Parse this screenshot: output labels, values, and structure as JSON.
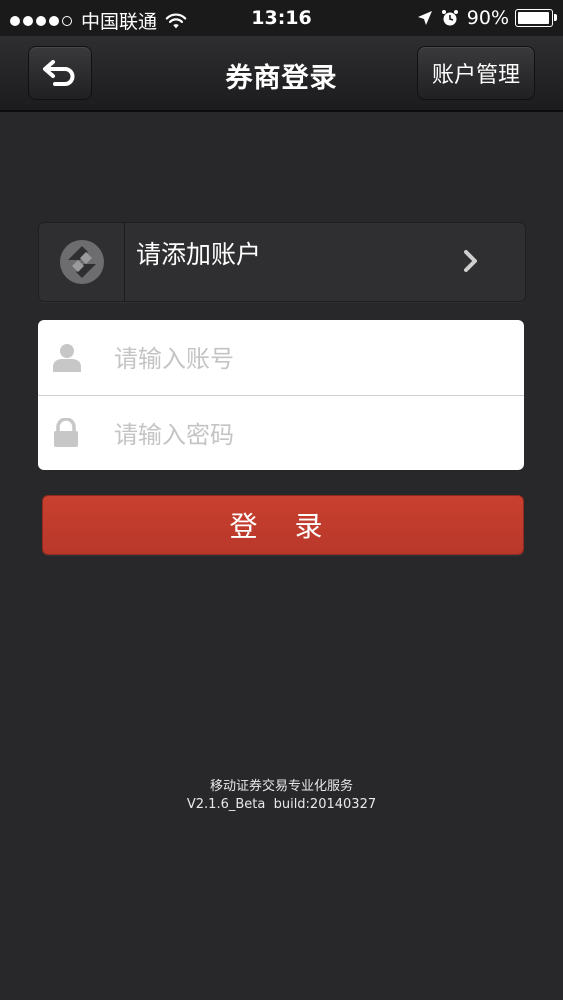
{
  "status_bar": {
    "carrier": "中国联通",
    "time": "13:16",
    "battery": "90%",
    "battery_level": 0.9,
    "signal_bars_filled": 4,
    "signal_bars_total": 5
  },
  "nav": {
    "title": "券商登录",
    "account_management": "账户管理"
  },
  "account_selector": {
    "label": "请添加账户"
  },
  "login_form": {
    "account_placeholder": "请输入账号",
    "password_placeholder": "请输入密码",
    "login_label": "登 录"
  },
  "footer": {
    "tagline": "移动证券交易专业化服务",
    "version": "V2.1.6_Beta  build:20140327"
  },
  "colors": {
    "background": "#28282b",
    "login_button": "#c13d2d"
  },
  "icons": {
    "back": "back-arrow-icon",
    "broker_logo": "broker-logo-icon",
    "chevron": "chevron-right-icon",
    "user": "user-icon",
    "lock": "lock-icon",
    "wifi": "wifi-icon",
    "location": "location-arrow-icon",
    "alarm": "alarm-icon",
    "battery": "battery-icon"
  }
}
